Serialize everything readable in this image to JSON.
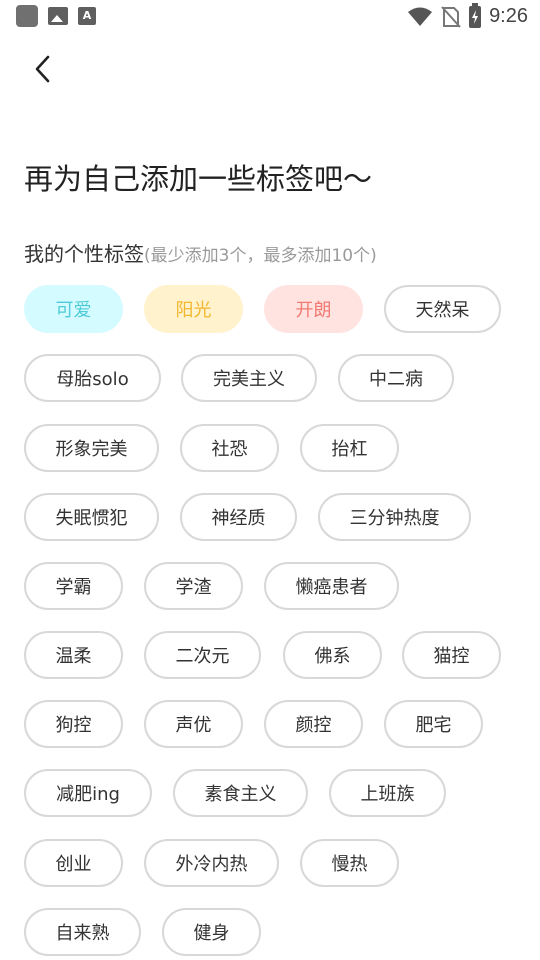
{
  "status_bar": {
    "time": "9:26",
    "icons": [
      "app-icon",
      "image-icon",
      "text-a-icon",
      "wifi-icon",
      "no-sim-icon",
      "battery-charging-icon"
    ],
    "a_glyph": "A"
  },
  "header": {
    "title": "再为自己添加一些标签吧～",
    "back_icon": "chevron-left-icon"
  },
  "section": {
    "label": "我的个性标签",
    "hint": "(最少添加3个，最多添加10个)"
  },
  "colors": {
    "cyan_bg": "#d4fbff",
    "cyan_text": "#4ecbd6",
    "yellow_bg": "#fff2cc",
    "yellow_text": "#f2b72e",
    "pink_bg": "#ffe3e1",
    "pink_text": "#f27a72",
    "border": "#d8d8d8"
  },
  "tags": [
    {
      "label": "可爱",
      "selected": true,
      "color": "cyan"
    },
    {
      "label": "阳光",
      "selected": true,
      "color": "yellow"
    },
    {
      "label": "开朗",
      "selected": true,
      "color": "pink"
    },
    {
      "label": "天然呆",
      "selected": false
    },
    {
      "label": "母胎solo",
      "selected": false
    },
    {
      "label": "完美主义",
      "selected": false
    },
    {
      "label": "中二病",
      "selected": false
    },
    {
      "label": "形象完美",
      "selected": false
    },
    {
      "label": "社恐",
      "selected": false
    },
    {
      "label": "抬杠",
      "selected": false
    },
    {
      "label": "失眠惯犯",
      "selected": false
    },
    {
      "label": "神经质",
      "selected": false
    },
    {
      "label": "三分钟热度",
      "selected": false
    },
    {
      "label": "学霸",
      "selected": false
    },
    {
      "label": "学渣",
      "selected": false
    },
    {
      "label": "懒癌患者",
      "selected": false
    },
    {
      "label": "温柔",
      "selected": false
    },
    {
      "label": "二次元",
      "selected": false
    },
    {
      "label": "佛系",
      "selected": false
    },
    {
      "label": "猫控",
      "selected": false
    },
    {
      "label": "狗控",
      "selected": false
    },
    {
      "label": "声优",
      "selected": false
    },
    {
      "label": "颜控",
      "selected": false
    },
    {
      "label": "肥宅",
      "selected": false
    },
    {
      "label": "减肥ing",
      "selected": false
    },
    {
      "label": "素食主义",
      "selected": false
    },
    {
      "label": "上班族",
      "selected": false
    },
    {
      "label": "创业",
      "selected": false
    },
    {
      "label": "外冷内热",
      "selected": false
    },
    {
      "label": "慢热",
      "selected": false
    },
    {
      "label": "自来熟",
      "selected": false
    },
    {
      "label": "健身",
      "selected": false
    }
  ]
}
